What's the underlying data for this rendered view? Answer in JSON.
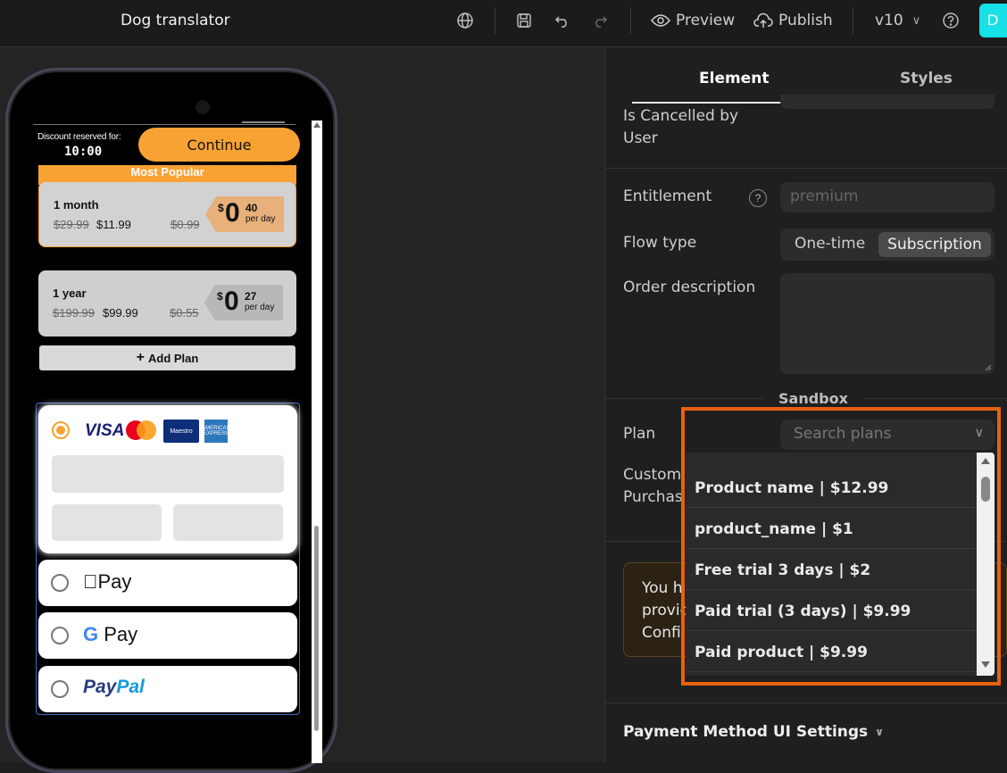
{
  "topbar": {
    "title": "Dog translator",
    "preview_label": "Preview",
    "publish_label": "Publish",
    "version": "v10",
    "avatar_initial": "D"
  },
  "phone": {
    "discount_label": "Discount reserved for:",
    "timer": "10:00",
    "continue_label": "Continue",
    "most_popular": "Most Popular",
    "plans": [
      {
        "name": "1 month",
        "old_price": "$29.99",
        "price": "$11.99",
        "old_per_day": "$0.99",
        "currency": "$",
        "whole": "0",
        "cents": "40",
        "per_day": "per day"
      },
      {
        "name": "1 year",
        "old_price": "$199.99",
        "price": "$99.99",
        "old_per_day": "$0.55",
        "currency": "$",
        "whole": "0",
        "cents": "27",
        "per_day": "per day"
      }
    ],
    "add_plan": "Add Plan",
    "card_brands": {
      "visa": "VISA",
      "maestro": "Maestro",
      "amex": "AMERICAN EXPRESS"
    },
    "apple_pay": "Pay",
    "google_pay_g": "G",
    "google_pay": "Pay",
    "paypal_a": "Pay",
    "paypal_b": "Pal"
  },
  "panel": {
    "tabs": [
      "Element",
      "Styles"
    ],
    "is_cancelled_label_1": "Is Cancelled by",
    "is_cancelled_label_2": "User",
    "entitlement_label": "Entitlement",
    "entitlement_placeholder": "premium",
    "flow_type_label": "Flow type",
    "flow_options": [
      "One-time",
      "Subscription"
    ],
    "order_description_label": "Order description",
    "sandbox_label": "Sandbox",
    "plan_label": "Plan",
    "plan_search_placeholder": "Search plans",
    "custom_label_1": "Custom",
    "custom_label_2": "Purchas",
    "notice_lines": [
      "You h",
      "provid",
      "Confi"
    ],
    "payment_method_settings": "Payment Method UI Settings"
  },
  "dropdown": {
    "options": [
      "Product name | $12.99",
      "product_name | $1",
      "Free trial 3 days | $2",
      "Paid trial (3 days) | $9.99",
      "Paid product | $9.99"
    ]
  },
  "colors": {
    "accent": "#f7a233",
    "highlight": "#e8610e",
    "avatar": "#17e0e6"
  }
}
